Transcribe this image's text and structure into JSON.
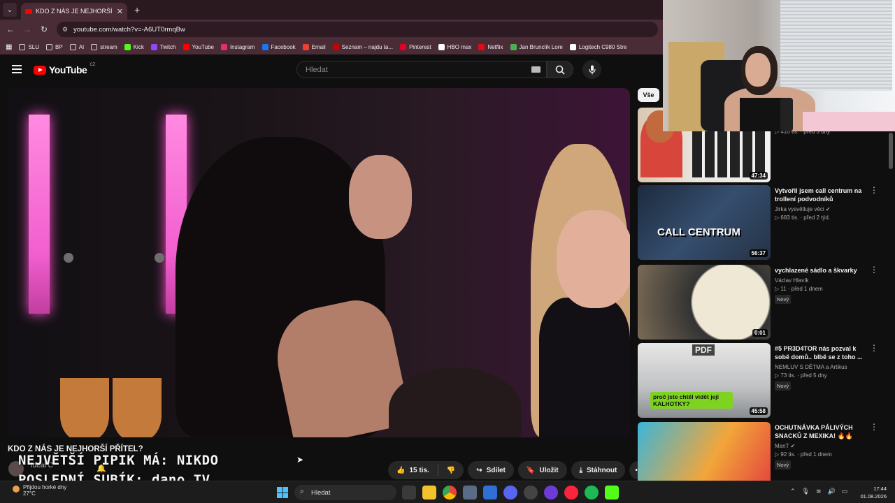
{
  "browser": {
    "tab_title": "KDO Z NÁS JE NEJHORŠÍ PŘÍTEL",
    "address": "youtube.com/watch?v=-A6UT0rmqBw",
    "bookmarks": [
      {
        "label": "SLU",
        "icon": "folder-icon",
        "color": "#cfcfcf"
      },
      {
        "label": "BP",
        "icon": "folder-icon",
        "color": "#cfcfcf"
      },
      {
        "label": "AI",
        "icon": "folder-icon",
        "color": "#cfcfcf"
      },
      {
        "label": "stream",
        "icon": "folder-icon",
        "color": "#cfcfcf"
      },
      {
        "label": "Kick",
        "icon": "kick-icon",
        "color": "#53fc18"
      },
      {
        "label": "Twitch",
        "icon": "twitch-icon",
        "color": "#9146ff"
      },
      {
        "label": "YouTube",
        "icon": "youtube-icon",
        "color": "#ff0000"
      },
      {
        "label": "Instagram",
        "icon": "instagram-icon",
        "color": "#e1306c"
      },
      {
        "label": "Facebook",
        "icon": "facebook-icon",
        "color": "#1877f2"
      },
      {
        "label": "Email",
        "icon": "email-icon",
        "color": "#e94235"
      },
      {
        "label": "Seznam – najdu ta...",
        "icon": "seznam-icon",
        "color": "#cc0000"
      },
      {
        "label": "Pinterest",
        "icon": "pinterest-icon",
        "color": "#e60023"
      },
      {
        "label": "HBO max",
        "icon": "hbo-icon",
        "color": "#ffffff"
      },
      {
        "label": "Netflix",
        "icon": "netflix-icon",
        "color": "#e50914"
      },
      {
        "label": "Jan Brunclík Lore",
        "icon": "leaf-icon",
        "color": "#4caf50"
      },
      {
        "label": "Logitech C980 Stre",
        "icon": "logitech-icon",
        "color": "#ffffff"
      }
    ]
  },
  "youtube": {
    "logo_text": "YouTube",
    "country": "CZ",
    "search_placeholder": "Hledat",
    "video": {
      "title": "KDO Z NÁS JE NEJHORŠÍ PŘÍTEL?",
      "channel": "Ideal C",
      "likes": "15 tis.",
      "share": "Sdílet",
      "save": "Uložit",
      "download": "Stáhnout"
    },
    "overlay": {
      "line1": "NEJVĚTŠÍ PIPIK MÁ: NIKDO",
      "line2": "POSLEDNÍ SUBÍK: dano_TV"
    },
    "chip_all": "Vše",
    "recommendations": [
      {
        "title": "",
        "channel": "",
        "views": "416 tis.",
        "age": "před 3 dny",
        "duration": "47:34",
        "badge": ""
      },
      {
        "title": "Vytvořil jsem call centrum na trollení podvodníků",
        "channel": "Jirka vysvětluje věci",
        "views": "683 tis.",
        "age": "před 2 týd.",
        "duration": "56:37",
        "badge": ""
      },
      {
        "title": "vychlazené sádlo a škvarky",
        "channel": "Václav Hlavík",
        "views": "11",
        "age": "před 1 dnem",
        "duration": "0:01",
        "badge": "Nový"
      },
      {
        "title": "#5 PR3D4TOR nás pozval k sobě domů.. blbě se z toho ...",
        "channel": "NEMLUV S DĚTMA a Artikus",
        "views": "73 tis.",
        "age": "před 5 dny",
        "duration": "45:58",
        "badge": "Nový"
      },
      {
        "title": "OCHUTNÁVKA PÁLIVÝCH SNACKŮ Z MEXIKA! 🔥🔥",
        "channel": "MenT",
        "views": "92 tis.",
        "age": "před 1 dnem",
        "duration": "",
        "badge": "Nový"
      }
    ],
    "thumb_texts": {
      "call_centrum": "CALL CENTRUM",
      "kalhotky": "proč jste chtěl vidět její KALHOTKY?",
      "pdf": "PDF"
    }
  },
  "taskbar": {
    "weather_line1": "Přijdou horké dny",
    "weather_line2": "27°C",
    "search": "Hledat",
    "time": "17:44",
    "date": "01.08.2026"
  },
  "colors": {
    "accent": "#ff0000",
    "chrome_frame": "#4a2c37"
  }
}
